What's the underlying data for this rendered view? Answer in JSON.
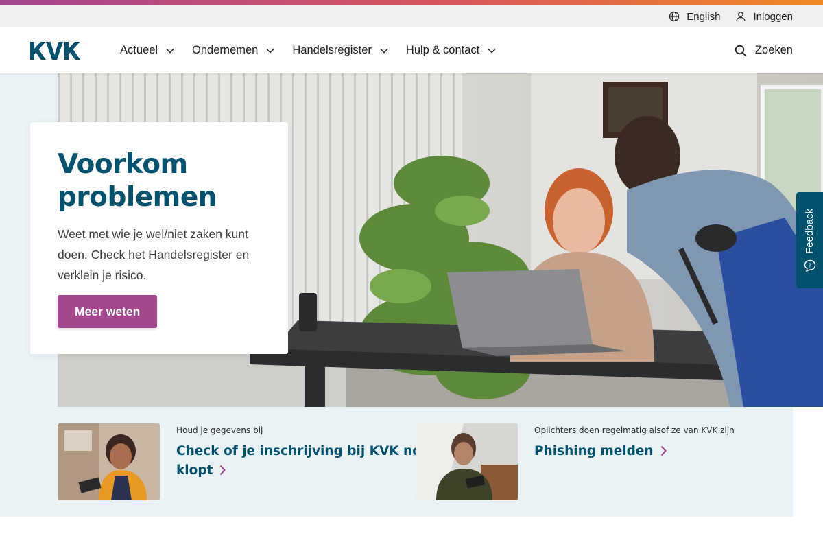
{
  "brand": {
    "logo_text": "KVK",
    "primary_color": "#00526e",
    "accent_color": "#a4478f",
    "accent_gradient": [
      "#a4478f",
      "#d8565e",
      "#f08a23"
    ]
  },
  "utility_nav": {
    "language": {
      "label": "English",
      "icon": "globe-icon"
    },
    "login": {
      "label": "Inloggen",
      "icon": "user-icon"
    }
  },
  "main_nav": {
    "items": [
      {
        "label": "Actueel",
        "icon": "chevron-down-icon"
      },
      {
        "label": "Ondernemen",
        "icon": "chevron-down-icon"
      },
      {
        "label": "Handelsregister",
        "icon": "chevron-down-icon"
      },
      {
        "label": "Hulp & contact",
        "icon": "chevron-down-icon"
      }
    ],
    "search": {
      "label": "Zoeken",
      "icon": "search-icon"
    }
  },
  "hero": {
    "title_line1": "Voorkom",
    "title_line2": "problemen",
    "text": "Weet met wie je wel/niet zaken kunt doen. Check het Handelsregister en verklein je risico.",
    "button_label": "Meer weten"
  },
  "feedback": {
    "label": "Feedback",
    "icon": "feedback-icon"
  },
  "teasers": [
    {
      "kicker": "Houd je gegevens bij",
      "link_line1": "Check of je inschrijving bij KVK nog",
      "link_line2": "klopt"
    },
    {
      "kicker": "Oplichters doen regelmatig alsof ze van KVK zijn",
      "link_line1": "Phishing melden"
    }
  ]
}
